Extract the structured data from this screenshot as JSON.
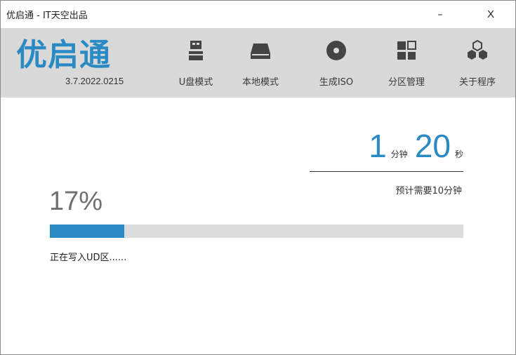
{
  "window": {
    "title": "优启通 - IT天空出品",
    "minimize_label": "–",
    "close_label": "X"
  },
  "brand": {
    "logo_text": "优启通",
    "version": "3.7.2022.0215",
    "accent_color": "#2a8ac4"
  },
  "nav": [
    {
      "label": "U盘模式",
      "icon": "usb-drive-icon"
    },
    {
      "label": "本地模式",
      "icon": "hard-disk-icon"
    },
    {
      "label": "生成ISO",
      "icon": "disc-icon"
    },
    {
      "label": "分区管理",
      "icon": "partition-icon"
    },
    {
      "label": "关于程序",
      "icon": "about-cubes-icon"
    }
  ],
  "timer": {
    "minutes": "1",
    "minutes_unit": "分钟",
    "seconds": "20",
    "seconds_unit": "秒",
    "estimate_text": "预计需要10分钟"
  },
  "progress": {
    "percent_text": "17%",
    "value": 0.18,
    "status_text": "正在写入UD区......"
  }
}
